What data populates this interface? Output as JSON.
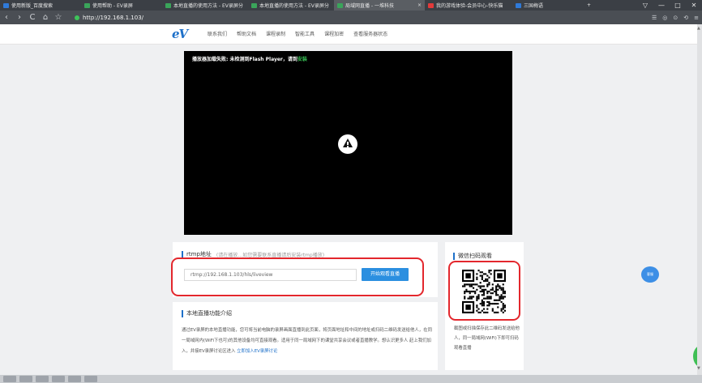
{
  "browser": {
    "tabs": [
      {
        "title": "使用新版_百度搜索",
        "color": "#2f7ad9",
        "active": false
      },
      {
        "title": "使用帮助 - EV录屏",
        "color": "#3aa55a",
        "active": false
      },
      {
        "title": "本地直播的使用方法 - EV录屏分",
        "color": "#3aa55a",
        "active": false
      },
      {
        "title": "本地直播的使用方法 - EV录屏分",
        "color": "#3aa55a",
        "active": false
      },
      {
        "title": "局域网直播 - 一堆科技",
        "color": "#3aa55a",
        "active": true
      },
      {
        "title": "我的游戏体验-会员中心-快乐猫",
        "color": "#e23a3a",
        "active": false
      },
      {
        "title": "三国梅语",
        "color": "#2f7ad9",
        "active": false
      }
    ],
    "new_tab": "+",
    "window_controls": [
      "▽",
      "—",
      "□",
      "✕"
    ],
    "back": "‹",
    "forward": "›",
    "reload": "C",
    "home": "⌂",
    "star": "☆",
    "url": "http://192.168.1.103/",
    "right_icons": [
      "☰",
      "◎",
      "⊙",
      "⟲",
      "≡"
    ]
  },
  "site": {
    "logo": "eV",
    "nav": [
      "联系我们",
      "帮助文档",
      "课程录制",
      "智能工具",
      "课程加密",
      "查看服务器状态"
    ]
  },
  "player": {
    "warning": "播放器加载失败: 未检测到Flash Player，请到",
    "warning_link": "安装"
  },
  "rtmp": {
    "title": "rtmp地址",
    "hint": "(请在播放…如您需要联系直播请后安装rtmp播放)",
    "input_value": "rtmp://192.168.1.103/hls/liveview",
    "play_button": "开始观看直播"
  },
  "intro": {
    "title": "本地直播功能介绍",
    "text": "通过EV录屏的本地直播功能，您可将当前电脑的录屏画面直播到此页面，将页面地址和中间的地址或扫码二维码发送给他人，在同一局域网内(WiFi下也可)的其他设备均可直接观看。适用于同一局域网下的课堂共享会议或者直播教学。想认识更多人 赶上我们加入，并接EV录屏讨论区进入",
    "link": "立即加入EV录屏讨论"
  },
  "qr": {
    "title": "微信扫码观看",
    "caption": "截图或扫描保存此二维码发送给他人，同一局域网(WiFi)下即可扫码观看直播",
    "icon": "qr-code-icon"
  },
  "floating_button": {
    "label": "客服",
    "color": "#3d8fe6"
  },
  "accent_colors": {
    "highlight": "#e3272d",
    "primary": "#2b8fe0"
  }
}
